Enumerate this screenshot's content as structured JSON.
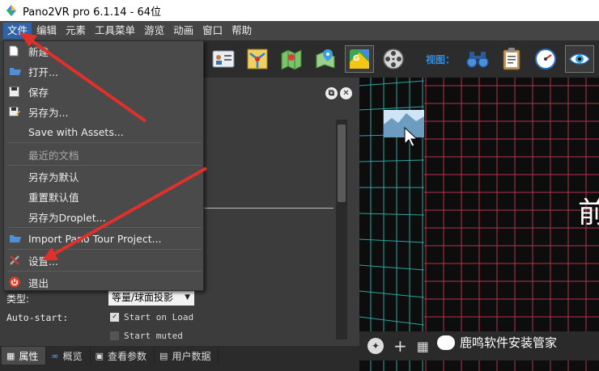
{
  "window": {
    "title": "Pano2VR pro 6.1.14 - 64位"
  },
  "menubar": {
    "items": [
      "文件",
      "编辑",
      "元素",
      "工具菜单",
      "游览",
      "动画",
      "窗口",
      "帮助"
    ]
  },
  "file_menu": {
    "new": "新建",
    "open": "打开...",
    "save": "保存",
    "save_as": "另存为...",
    "save_with_assets": "Save with Assets...",
    "recent": "最近的文档",
    "save_as_default": "另存为默认",
    "reset_default": "重置默认值",
    "save_as_droplet": "另存为Droplet...",
    "import_project": "Import Pano Tour Project...",
    "settings": "设置...",
    "quit": "退出"
  },
  "toolbar": {
    "view_label": "视图："
  },
  "properties": {
    "type_label": "类型:",
    "type_value": "等量/球面投影",
    "autostart_label": "Auto-start:",
    "start_on_load": "Start on Load",
    "start_muted": "Start muted"
  },
  "bottom_tabs": [
    "属性",
    "概览",
    "查看参数",
    "用户数据"
  ],
  "viewer": {
    "overlay_text": "前"
  },
  "watermark": "鹿鸣软件安装管家",
  "colors": {
    "menu_active": "#2f64a8",
    "arrow": "#e0302c",
    "grid_left": "#2aa7a0",
    "grid_right": "#b8324a",
    "view_label": "#2e8fe6"
  }
}
